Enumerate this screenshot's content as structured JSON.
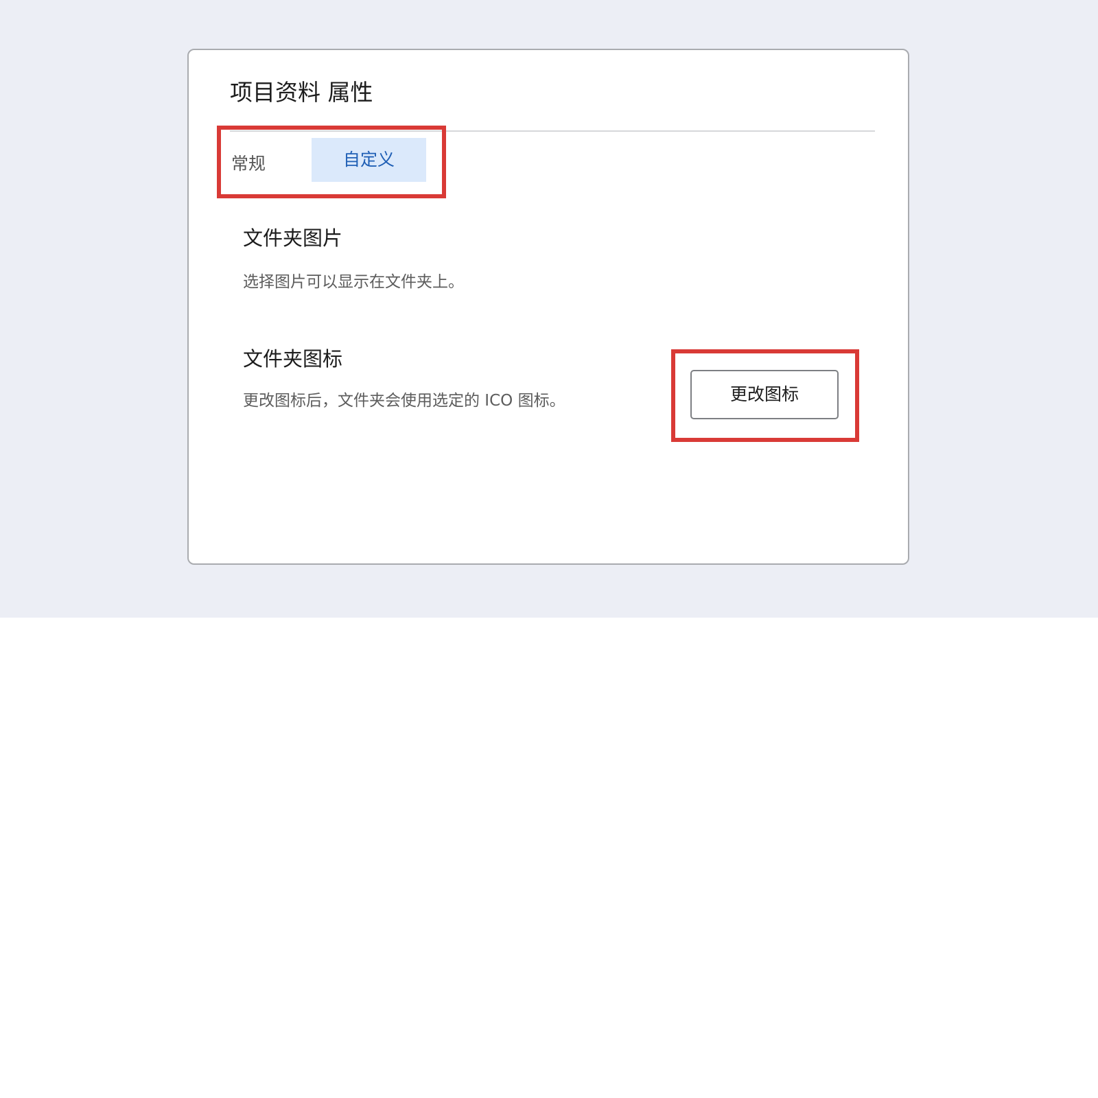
{
  "dialog": {
    "title": "项目资料 属性"
  },
  "tabs": [
    {
      "label": "常规",
      "active": false
    },
    {
      "label": "自定义",
      "active": true
    }
  ],
  "sections": {
    "folder_picture": {
      "heading": "文件夹图片",
      "description": "选择图片可以显示在文件夹上。"
    },
    "folder_icon": {
      "heading": "文件夹图标",
      "description": "更改图标后，文件夹会使用选定的 ICO 图标。",
      "button_label": "更改图标"
    }
  },
  "colors": {
    "backdrop": "#eceef5",
    "active_tab_bg": "#dbe9fb",
    "active_tab_text": "#1f5fb5",
    "highlight_box": "#d93a36"
  }
}
